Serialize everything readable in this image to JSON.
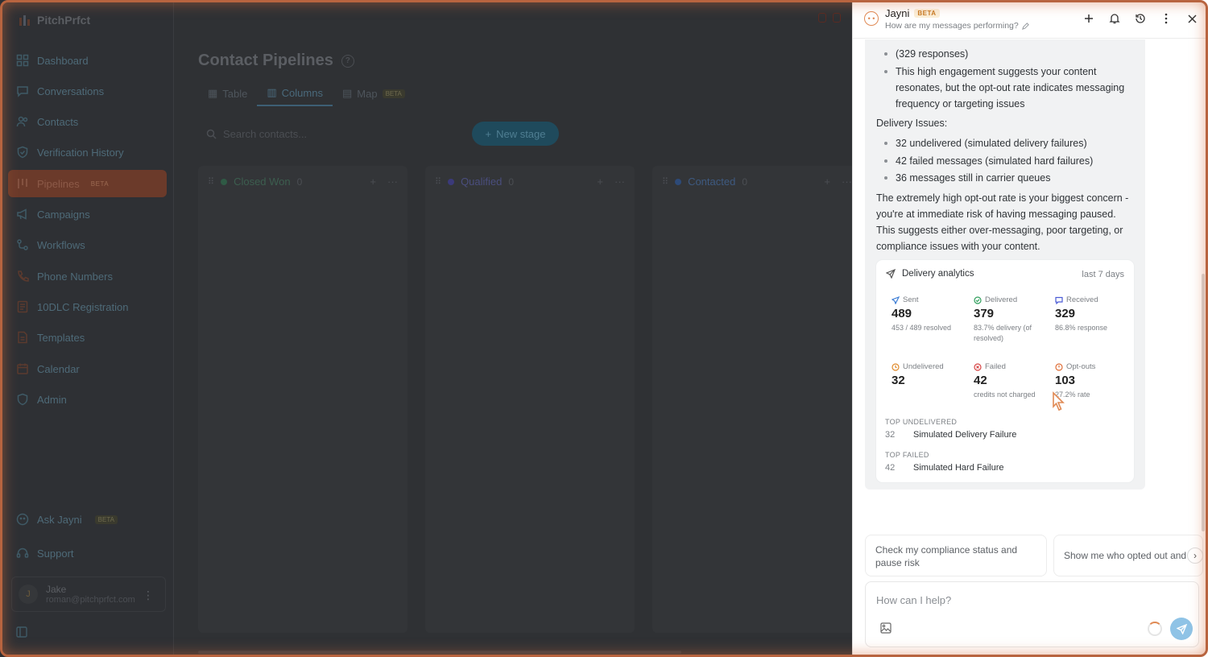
{
  "app": {
    "logo": "PitchPrfct",
    "nav": [
      {
        "label": "Dashboard",
        "icon": "dashboard-icon"
      },
      {
        "label": "Conversations",
        "icon": "chat-icon"
      },
      {
        "label": "Contacts",
        "icon": "users-icon"
      },
      {
        "label": "Verification History",
        "icon": "shield-check-icon"
      },
      {
        "label": "Pipelines",
        "icon": "pipeline-icon",
        "badge": "BETA",
        "active": true
      },
      {
        "label": "Campaigns",
        "icon": "megaphone-icon"
      },
      {
        "label": "Workflows",
        "icon": "workflow-icon"
      },
      {
        "label": "Phone Numbers",
        "icon": "phone-icon"
      },
      {
        "label": "10DLC Registration",
        "icon": "registration-icon"
      },
      {
        "label": "Templates",
        "icon": "template-icon"
      },
      {
        "label": "Calendar",
        "icon": "calendar-icon"
      },
      {
        "label": "Admin",
        "icon": "admin-shield-icon"
      }
    ],
    "ask_jayni": {
      "label": "Ask Jayni",
      "badge": "BETA"
    },
    "support": "Support",
    "user": {
      "initial": "J",
      "name": "Jake",
      "email": "roman@pitchprfct.com"
    }
  },
  "main": {
    "title": "Contact Pipelines",
    "tabs": [
      {
        "label": "Table",
        "active": false
      },
      {
        "label": "Columns",
        "active": true
      },
      {
        "label": "Map",
        "active": false,
        "badge": "BETA"
      }
    ],
    "search_placeholder": "Search contacts...",
    "new_stage": "New stage",
    "stages": [
      {
        "name": "Closed Won",
        "count": "0",
        "color": "#2f5a45"
      },
      {
        "name": "Qualified",
        "count": "0",
        "color": "#3b3a7a"
      },
      {
        "name": "Contacted",
        "count": "0",
        "color": "#2d4a78"
      }
    ]
  },
  "panel": {
    "title": "Jayni",
    "badge": "BETA",
    "subtitle": "How are my messages performing?",
    "message": {
      "bullets_top": [
        "(329 responses)",
        "This high engagement suggests your content resonates, but the opt-out rate indicates messaging frequency or targeting issues"
      ],
      "delivery_heading": "Delivery Issues:",
      "delivery_bullets": [
        "32 undelivered (simulated delivery failures)",
        "42 failed messages (simulated hard failures)",
        "36 messages still in carrier queues"
      ],
      "summary": "The extremely high opt-out rate is your biggest concern - you're at immediate risk of having messaging paused. This suggests either over-messaging, poor targeting, or compliance issues with your content."
    },
    "analytics": {
      "title": "Delivery analytics",
      "period": "last 7 days",
      "metrics": [
        {
          "label": "Sent",
          "value": "489",
          "note": "453 / 489 resolved",
          "color": "#3a7bd5",
          "icon": "send-icon"
        },
        {
          "label": "Delivered",
          "value": "379",
          "note": "83.7% delivery (of resolved)",
          "color": "#2e9e5b",
          "icon": "check-circle-icon"
        },
        {
          "label": "Received",
          "value": "329",
          "note": "86.8% response",
          "color": "#4a5bd6",
          "icon": "message-icon"
        },
        {
          "label": "Undelivered",
          "value": "32",
          "note": "",
          "color": "#e08a2a",
          "icon": "clock-icon"
        },
        {
          "label": "Failed",
          "value": "42",
          "note": "credits not charged",
          "color": "#d64545",
          "icon": "x-circle-icon"
        },
        {
          "label": "Opt-outs",
          "value": "103",
          "note": "27.2% rate",
          "color": "#e0703a",
          "icon": "optout-icon"
        }
      ],
      "top_undelivered_label": "TOP UNDELIVERED",
      "top_undelivered": {
        "count": "32",
        "reason": "Simulated Delivery Failure"
      },
      "top_failed_label": "TOP FAILED",
      "top_failed": {
        "count": "42",
        "reason": "Simulated Hard Failure"
      }
    },
    "suggestions": [
      "Check my compliance status and pause risk",
      "Show me who opted out and"
    ],
    "composer_placeholder": "How can I help?"
  }
}
